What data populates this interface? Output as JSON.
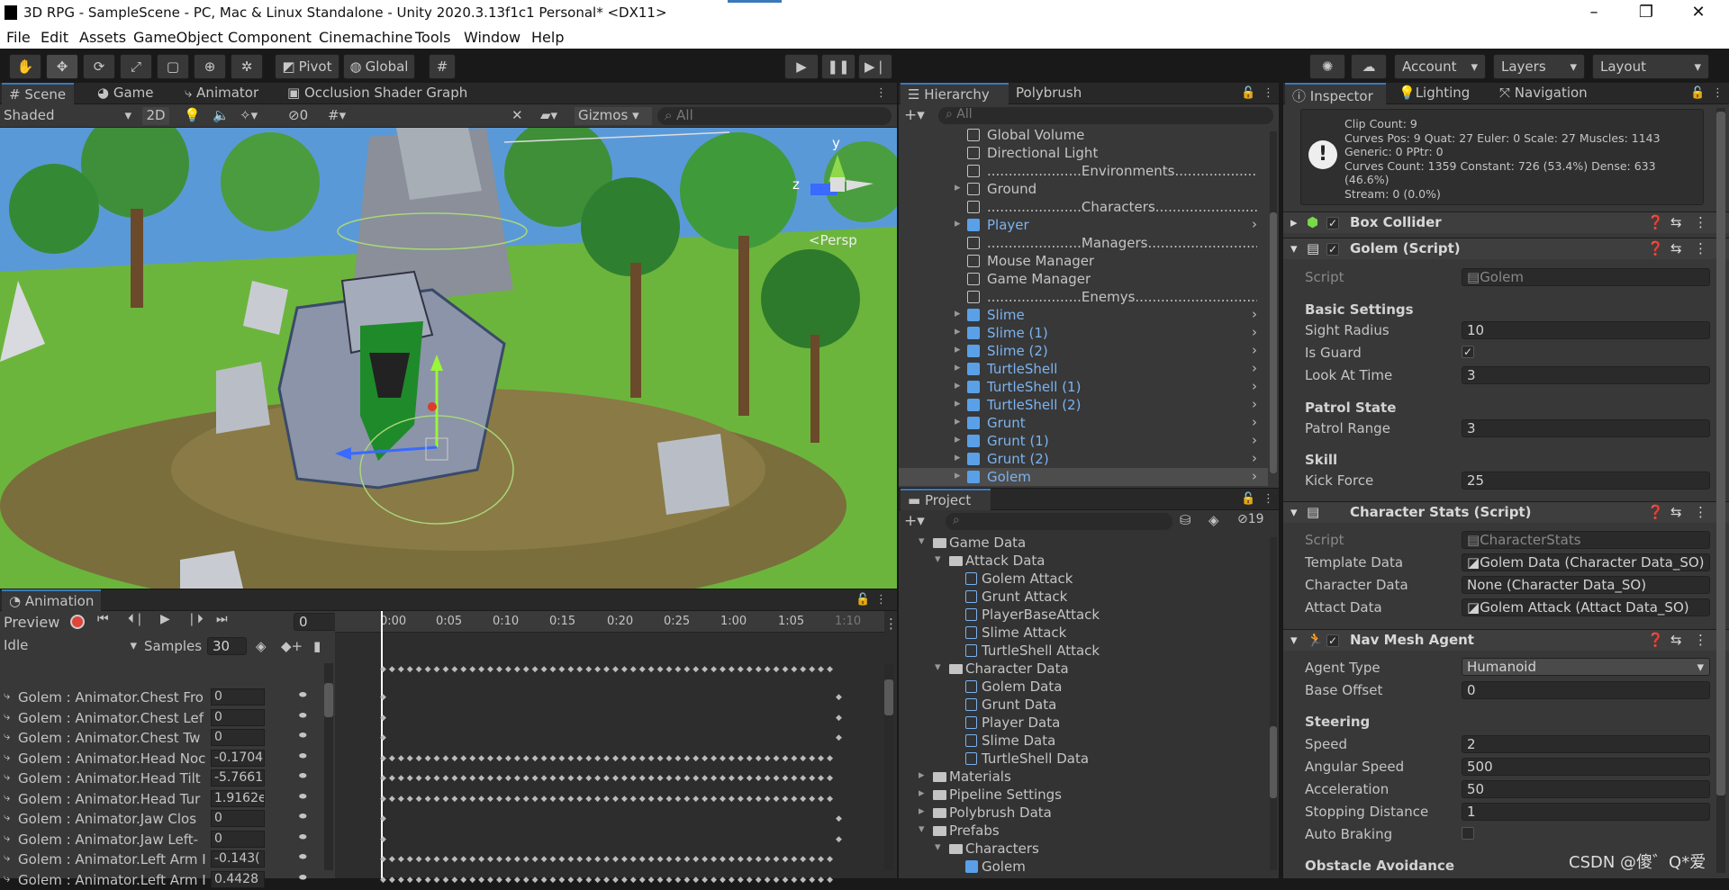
{
  "window": {
    "title": "3D RPG - SampleScene - PC, Mac & Linux Standalone - Unity 2020.3.13f1c1 Personal* <DX11>"
  },
  "menu": [
    "File",
    "Edit",
    "Assets",
    "GameObject",
    "Component",
    "Cinemachine",
    "Tools",
    "Window",
    "Help"
  ],
  "toolbar": {
    "pivot": "Pivot",
    "global": "Global",
    "account": "Account",
    "layers": "Layers",
    "layout": "Layout"
  },
  "scene_tabs": {
    "scene": "Scene",
    "game": "Game",
    "animator": "Animator",
    "occlusion": "Occlusion Shader Graph"
  },
  "scene_bar": {
    "shading": "Shaded",
    "mode2d": "2D",
    "hidden_count": "0",
    "gizmos": "Gizmos",
    "search_placeholder": "All"
  },
  "scene_gizmo": {
    "y": "y",
    "z": "z",
    "persp": "<Persp"
  },
  "animation": {
    "tab": "Animation",
    "preview": "Preview",
    "frame": "0",
    "clip": "Idle",
    "samples_label": "Samples",
    "samples": "30",
    "timeline": [
      "0:00",
      "0:05",
      "0:10",
      "0:15",
      "0:20",
      "0:25",
      "1:00",
      "1:05",
      "1:10"
    ],
    "rows": [
      {
        "name": "Golem : Animator.Chest Fro",
        "value": "0"
      },
      {
        "name": "Golem : Animator.Chest Lef",
        "value": "0"
      },
      {
        "name": "Golem : Animator.Chest Tw",
        "value": "0"
      },
      {
        "name": "Golem : Animator.Head Noc",
        "value": "-0.1704"
      },
      {
        "name": "Golem : Animator.Head Tilt",
        "value": "-5.7661"
      },
      {
        "name": "Golem : Animator.Head Tur",
        "value": "1.9162e"
      },
      {
        "name": "Golem : Animator.Jaw Clos",
        "value": "0"
      },
      {
        "name": "Golem : Animator.Jaw Left-",
        "value": "0"
      },
      {
        "name": "Golem : Animator.Left Arm I",
        "value": "-0.143("
      },
      {
        "name": "Golem : Animator.Left Arm I",
        "value": "0.4428"
      }
    ]
  },
  "hierarchy": {
    "tab": "Hierarchy",
    "tab2": "Polybrush",
    "search_placeholder": "All",
    "items": [
      {
        "label": "Global Volume",
        "prefab": false,
        "arrow": false
      },
      {
        "label": "Directional Light",
        "prefab": false,
        "arrow": false
      },
      {
        "label": "......................Environments..............................",
        "prefab": false,
        "arrow": false
      },
      {
        "label": "Ground",
        "prefab": false,
        "arrow": true
      },
      {
        "label": "......................Characters...............................",
        "prefab": false,
        "arrow": false
      },
      {
        "label": "Player",
        "prefab": true,
        "arrow": true
      },
      {
        "label": "......................Managers...............................",
        "prefab": false,
        "arrow": false
      },
      {
        "label": "Mouse Manager",
        "prefab": false,
        "arrow": false
      },
      {
        "label": "Game Manager",
        "prefab": false,
        "arrow": false
      },
      {
        "label": "......................Enemys...............................",
        "prefab": false,
        "arrow": false
      },
      {
        "label": "Slime",
        "prefab": true,
        "arrow": true
      },
      {
        "label": "Slime (1)",
        "prefab": true,
        "arrow": true
      },
      {
        "label": "Slime (2)",
        "prefab": true,
        "arrow": true
      },
      {
        "label": "TurtleShell",
        "prefab": true,
        "arrow": true
      },
      {
        "label": "TurtleShell (1)",
        "prefab": true,
        "arrow": true
      },
      {
        "label": "TurtleShell (2)",
        "prefab": true,
        "arrow": true
      },
      {
        "label": "Grunt",
        "prefab": true,
        "arrow": true
      },
      {
        "label": "Grunt (1)",
        "prefab": true,
        "arrow": true
      },
      {
        "label": "Grunt (2)",
        "prefab": true,
        "arrow": true
      },
      {
        "label": "Golem",
        "prefab": true,
        "arrow": true
      }
    ]
  },
  "project": {
    "tab": "Project",
    "hidden_count": "19",
    "items": [
      {
        "label": "Game Data",
        "type": "folder",
        "indent": 0
      },
      {
        "label": "Attack Data",
        "type": "folder",
        "indent": 1
      },
      {
        "label": "Golem Attack",
        "type": "so",
        "indent": 2
      },
      {
        "label": "Grunt Attack",
        "type": "so",
        "indent": 2
      },
      {
        "label": "PlayerBaseAttack",
        "type": "so",
        "indent": 2
      },
      {
        "label": "Slime Attack",
        "type": "so",
        "indent": 2
      },
      {
        "label": "TurtleShell Attack",
        "type": "so",
        "indent": 2
      },
      {
        "label": "Character Data",
        "type": "folder",
        "indent": 1
      },
      {
        "label": "Golem Data",
        "type": "so",
        "indent": 2
      },
      {
        "label": "Grunt Data",
        "type": "so",
        "indent": 2
      },
      {
        "label": "Player Data",
        "type": "so",
        "indent": 2
      },
      {
        "label": "Slime Data",
        "type": "so",
        "indent": 2
      },
      {
        "label": "TurtleShell Data",
        "type": "so",
        "indent": 2
      },
      {
        "label": "Materials",
        "type": "folder",
        "indent": 0
      },
      {
        "label": "Pipeline Settings",
        "type": "folder",
        "indent": 0
      },
      {
        "label": "Polybrush Data",
        "type": "folder",
        "indent": 0
      },
      {
        "label": "Prefabs",
        "type": "folder",
        "indent": 0
      },
      {
        "label": "Characters",
        "type": "folder",
        "indent": 1
      },
      {
        "label": "Golem",
        "type": "prefab",
        "indent": 2
      }
    ]
  },
  "inspector": {
    "tabs": [
      "Inspector",
      "Lighting",
      "Navigation"
    ],
    "info": [
      "Clip Count: 9",
      "Curves Pos: 9 Quat: 27 Euler: 0 Scale: 27 Muscles: 1143",
      "Generic: 0 PPtr: 0",
      "Curves Count: 1359 Constant: 726 (53.4%) Dense: 633 (46.6%)",
      "Stream: 0 (0.0%)"
    ],
    "box_collider": "Box Collider",
    "golem_script": {
      "title": "Golem (Script)",
      "script_label": "Script",
      "script_value": "Golem",
      "basic_settings": "Basic Settings",
      "sight_radius_label": "Sight Radius",
      "sight_radius": "10",
      "is_guard_label": "Is Guard",
      "look_at_time_label": "Look At Time",
      "look_at_time": "3",
      "patrol_state": "Patrol State",
      "patrol_range_label": "Patrol Range",
      "patrol_range": "3",
      "skill": "Skill",
      "kick_force_label": "Kick Force",
      "kick_force": "25"
    },
    "character_stats": {
      "title": "Character Stats (Script)",
      "script_label": "Script",
      "script_value": "CharacterStats",
      "template_label": "Template Data",
      "template_value": "Golem Data (Character Data_SO)",
      "char_label": "Character Data",
      "char_value": "None (Character Data_SO)",
      "attack_label": "Attact Data",
      "attack_value": "Golem Attack (Attact Data_SO)"
    },
    "nav_mesh": {
      "title": "Nav Mesh Agent",
      "agent_type_label": "Agent Type",
      "agent_type": "Humanoid",
      "base_offset_label": "Base Offset",
      "base_offset": "0",
      "steering": "Steering",
      "speed_label": "Speed",
      "speed": "2",
      "angular_label": "Angular Speed",
      "angular": "500",
      "accel_label": "Acceleration",
      "accel": "50",
      "stop_label": "Stopping Distance",
      "stop": "1",
      "autobrake_label": "Auto Braking",
      "obstacle": "Obstacle Avoidance"
    }
  },
  "watermark": "CSDN @傻゛Q*爱"
}
